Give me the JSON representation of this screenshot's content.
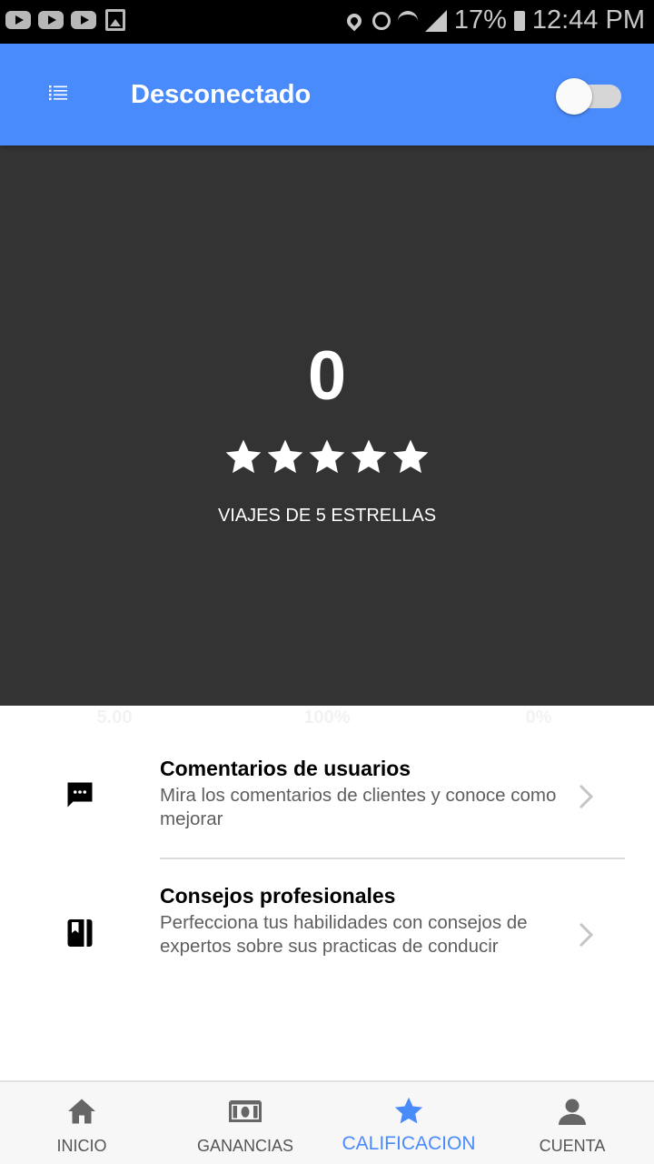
{
  "status_bar": {
    "battery": "17%",
    "time": "12:44 PM"
  },
  "app_bar": {
    "title": "Desconectado",
    "toggle_state": "off",
    "color": "#4a8bfc"
  },
  "hero": {
    "count": "0",
    "stars": 5,
    "label": "VIAJES DE 5 ESTRELLAS"
  },
  "stats": [
    "5.00",
    "100%",
    "0%"
  ],
  "list": [
    {
      "title": "Comentarios de usuarios",
      "subtitle": "Mira los comentarios de clientes y conoce como mejorar",
      "icon": "chat-bubble-icon"
    },
    {
      "title": "Consejos profesionales",
      "subtitle": "Perfecciona tus habilidades con consejos de expertos sobre sus practicas de conducir",
      "icon": "book-icon"
    }
  ],
  "bottom_nav": [
    {
      "label": "INICIO",
      "icon": "home-icon",
      "active": false
    },
    {
      "label": "GANANCIAS",
      "icon": "money-icon",
      "active": false
    },
    {
      "label": "CALIFICACION",
      "icon": "star-icon",
      "active": true
    },
    {
      "label": "CUENTA",
      "icon": "person-icon",
      "active": false
    }
  ]
}
